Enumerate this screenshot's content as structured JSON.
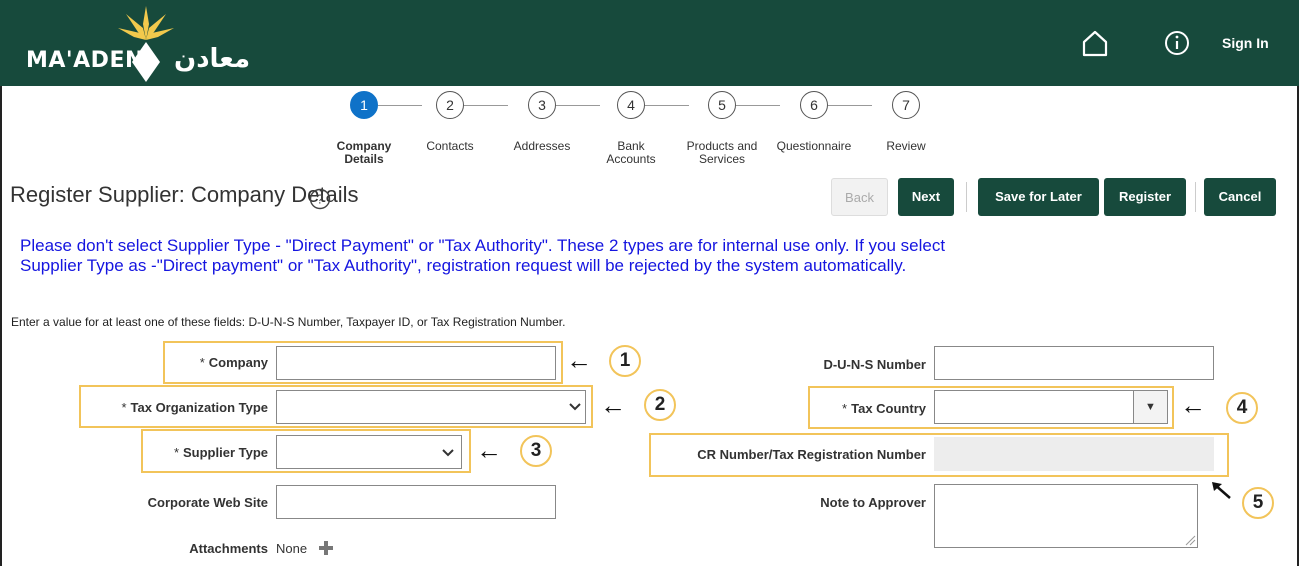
{
  "header": {
    "logo_en": "MA'ADEN",
    "logo_ar": "معادن",
    "sign_in": "Sign In",
    "home_icon": "home-icon",
    "info_icon": "info-icon",
    "bg_color": "#174a3c"
  },
  "train": {
    "steps": [
      {
        "number": "1",
        "label": "Company Details",
        "active": true
      },
      {
        "number": "2",
        "label": "Contacts",
        "active": false
      },
      {
        "number": "3",
        "label": "Addresses",
        "active": false
      },
      {
        "number": "4",
        "label": "Bank Accounts",
        "active": false
      },
      {
        "number": "5",
        "label": "Products and Services",
        "active": false
      },
      {
        "number": "6",
        "label": "Questionnaire",
        "active": false
      },
      {
        "number": "7",
        "label": "Review",
        "active": false
      }
    ]
  },
  "page": {
    "title": "Register Supplier: Company Details",
    "warning": "Please don't select Supplier Type - \"Direct Payment\" or \"Tax Authority\". These 2 types are for internal use only. If you select Supplier Type as -\"Direct payment\" or \"Tax Authority\", registration request will be rejected by the system automatically.",
    "note": "Enter a value for at least one of these fields: D-U-N-S Number, Taxpayer ID, or Tax Registration Number."
  },
  "buttons": {
    "back": "Back",
    "next": "Next",
    "save_for_later": "Save for Later",
    "register": "Register",
    "cancel": "Cancel"
  },
  "form": {
    "company": {
      "label": "Company",
      "required": true,
      "value": ""
    },
    "tax_org_type": {
      "label": "Tax Organization Type",
      "required": true,
      "value": ""
    },
    "supplier_type": {
      "label": "Supplier Type",
      "required": true,
      "value": ""
    },
    "corporate_web_site": {
      "label": "Corporate Web Site",
      "value": ""
    },
    "attachments": {
      "label": "Attachments",
      "value": "None"
    },
    "duns_number": {
      "label": "D-U-N-S Number",
      "value": ""
    },
    "tax_country": {
      "label": "Tax Country",
      "required": true,
      "value": ""
    },
    "cr_number": {
      "label": "CR Number/Tax Registration Number",
      "value": ""
    },
    "note_to_approver": {
      "label": "Note to Approver",
      "value": ""
    }
  },
  "callouts": [
    "1",
    "2",
    "3",
    "4",
    "5"
  ]
}
